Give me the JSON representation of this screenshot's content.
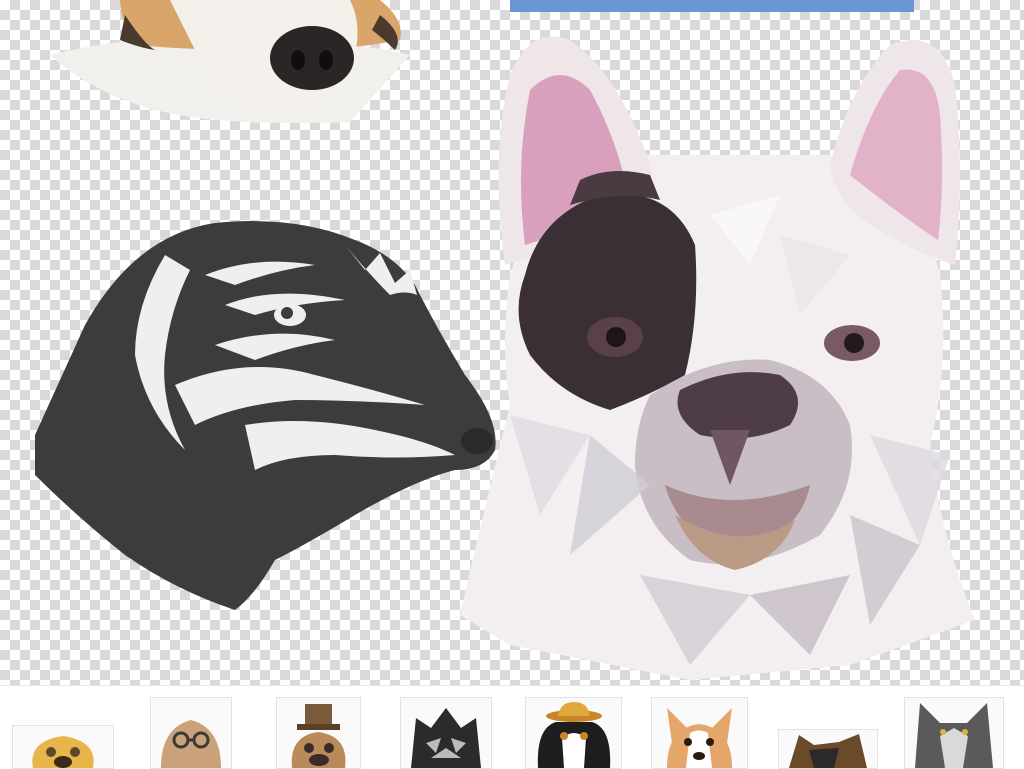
{
  "canvas": {
    "background": "transparency-checkerboard",
    "checker_color": "#d9d9d9"
  },
  "images": [
    {
      "name": "dog-nose-photo",
      "colors": [
        "#d9a56a",
        "#f2efe9",
        "#2b2525"
      ]
    },
    {
      "name": "blue-fabric-strip",
      "colors": [
        "#6a96d6"
      ]
    },
    {
      "name": "dachshund-silhouette",
      "colors": [
        "#3c3c3c",
        "#efefef"
      ]
    },
    {
      "name": "low-poly-french-bulldog",
      "colors": [
        "#f3eef0",
        "#3a2f35",
        "#d9a0bd",
        "#a88a8f"
      ]
    }
  ],
  "thumbnails": [
    {
      "name": "pug-thumbnail",
      "colors": [
        "#e8b54a",
        "#5a4a2a"
      ]
    },
    {
      "name": "greyhound-with-glasses-thumbnail",
      "colors": [
        "#c9a27a",
        "#3a3a3a"
      ]
    },
    {
      "name": "pug-with-top-hat-thumbnail",
      "colors": [
        "#7a5a3a",
        "#3a2a2a"
      ]
    },
    {
      "name": "black-line-art-dog-thumbnail",
      "colors": [
        "#2b2b2b",
        "#bbbbbb"
      ]
    },
    {
      "name": "spaniel-with-hat-thumbnail",
      "colors": [
        "#1e1e1e",
        "#e0a83c",
        "#c9852a"
      ]
    },
    {
      "name": "corgi-thumbnail",
      "colors": [
        "#e4a66a",
        "#ffffff"
      ]
    },
    {
      "name": "german-shepherd-thumbnail",
      "colors": [
        "#6b4a2a",
        "#2a2a2a"
      ]
    },
    {
      "name": "wolf-thumbnail",
      "colors": [
        "#5a5a5a",
        "#d9d9d9"
      ]
    }
  ]
}
